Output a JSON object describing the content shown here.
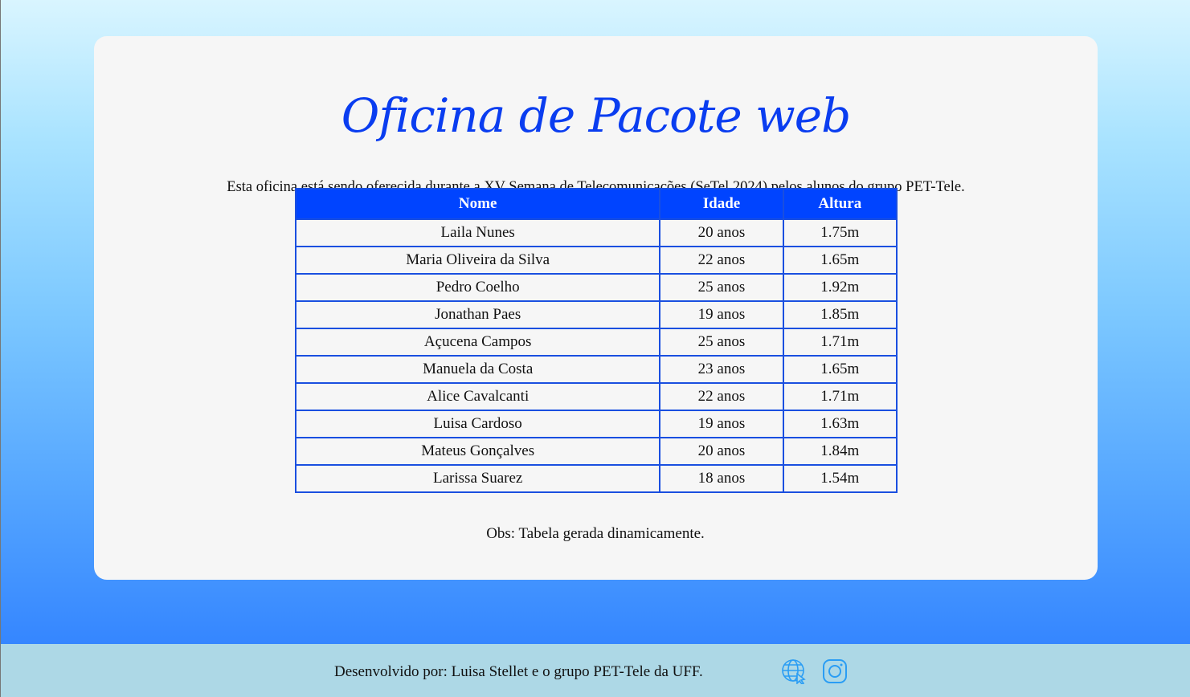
{
  "header": {
    "title": "Oficina de Pacote web",
    "intro": "Esta oficina está sendo oferecida durante a XV Semana de Telecomunicações (SeTel 2024) pelos alunos do grupo PET-Tele."
  },
  "table": {
    "columns": [
      "Nome",
      "Idade",
      "Altura"
    ],
    "rows": [
      [
        "Laila Nunes",
        "20 anos",
        "1.75m"
      ],
      [
        "Maria Oliveira da Silva",
        "22 anos",
        "1.65m"
      ],
      [
        "Pedro Coelho",
        "25 anos",
        "1.92m"
      ],
      [
        "Jonathan Paes",
        "19 anos",
        "1.85m"
      ],
      [
        "Açucena Campos",
        "25 anos",
        "1.71m"
      ],
      [
        "Manuela da Costa",
        "23 anos",
        "1.65m"
      ],
      [
        "Alice Cavalcanti",
        "22 anos",
        "1.71m"
      ],
      [
        "Luisa Cardoso",
        "19 anos",
        "1.63m"
      ],
      [
        "Mateus Gonçalves",
        "20 anos",
        "1.84m"
      ],
      [
        "Larissa Suarez",
        "18 anos",
        "1.54m"
      ]
    ]
  },
  "note": "Obs: Tabela gerada dinamicamente.",
  "footer": {
    "credit": "Desenvolvido por: Luisa Stellet e o grupo PET-Tele da UFF.",
    "icons": [
      "globe-icon",
      "instagram-icon"
    ]
  },
  "colors": {
    "accent": "#0044ff",
    "title": "#0a3df0",
    "card": "#f6f6f6",
    "footer": "#add8e6",
    "icon": "#2a9df4"
  }
}
